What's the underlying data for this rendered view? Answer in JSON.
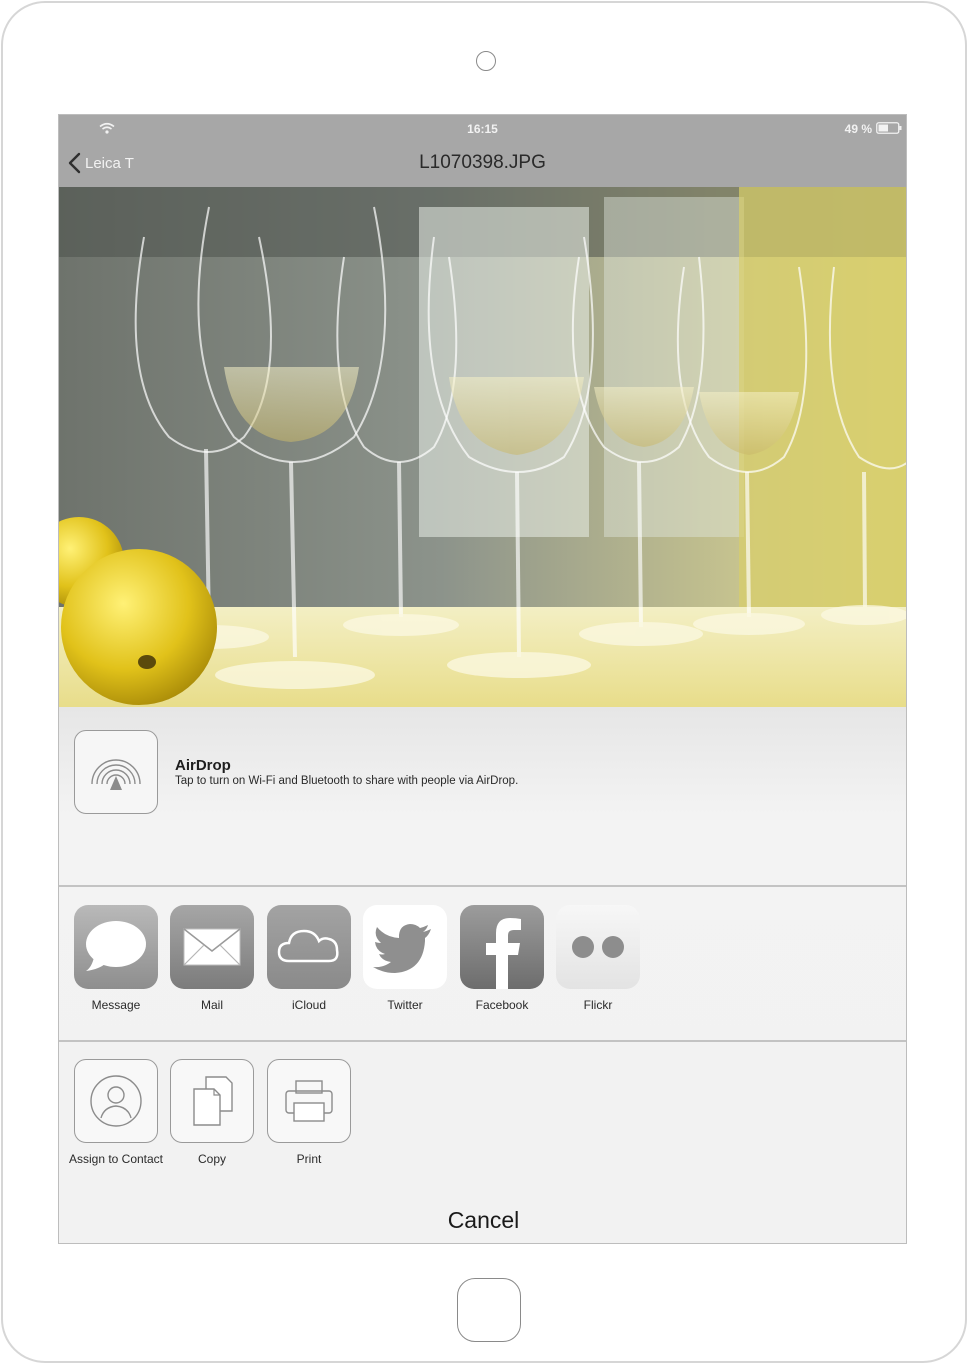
{
  "status": {
    "time": "16:15",
    "battery": "49 %"
  },
  "nav": {
    "back_label": "Leica T",
    "title": "L1070398.JPG"
  },
  "airdrop": {
    "title": "AirDrop",
    "description": "Tap to turn on Wi-Fi and Bluetooth to share with people via AirDrop."
  },
  "share_apps": [
    {
      "label": "Message",
      "icon": "message-icon"
    },
    {
      "label": "Mail",
      "icon": "mail-icon"
    },
    {
      "label": "iCloud",
      "icon": "icloud-icon"
    },
    {
      "label": "Twitter",
      "icon": "twitter-icon"
    },
    {
      "label": "Facebook",
      "icon": "facebook-icon"
    },
    {
      "label": "Flickr",
      "icon": "flickr-icon"
    }
  ],
  "actions": [
    {
      "label": "Assign to Contact",
      "icon": "contact-icon"
    },
    {
      "label": "Copy",
      "icon": "copy-icon"
    },
    {
      "label": "Print",
      "icon": "printer-icon"
    }
  ],
  "cancel_label": "Cancel",
  "colors": {
    "nav_bar": "#a7a7a7",
    "photo_accent": "#e8d63a"
  }
}
